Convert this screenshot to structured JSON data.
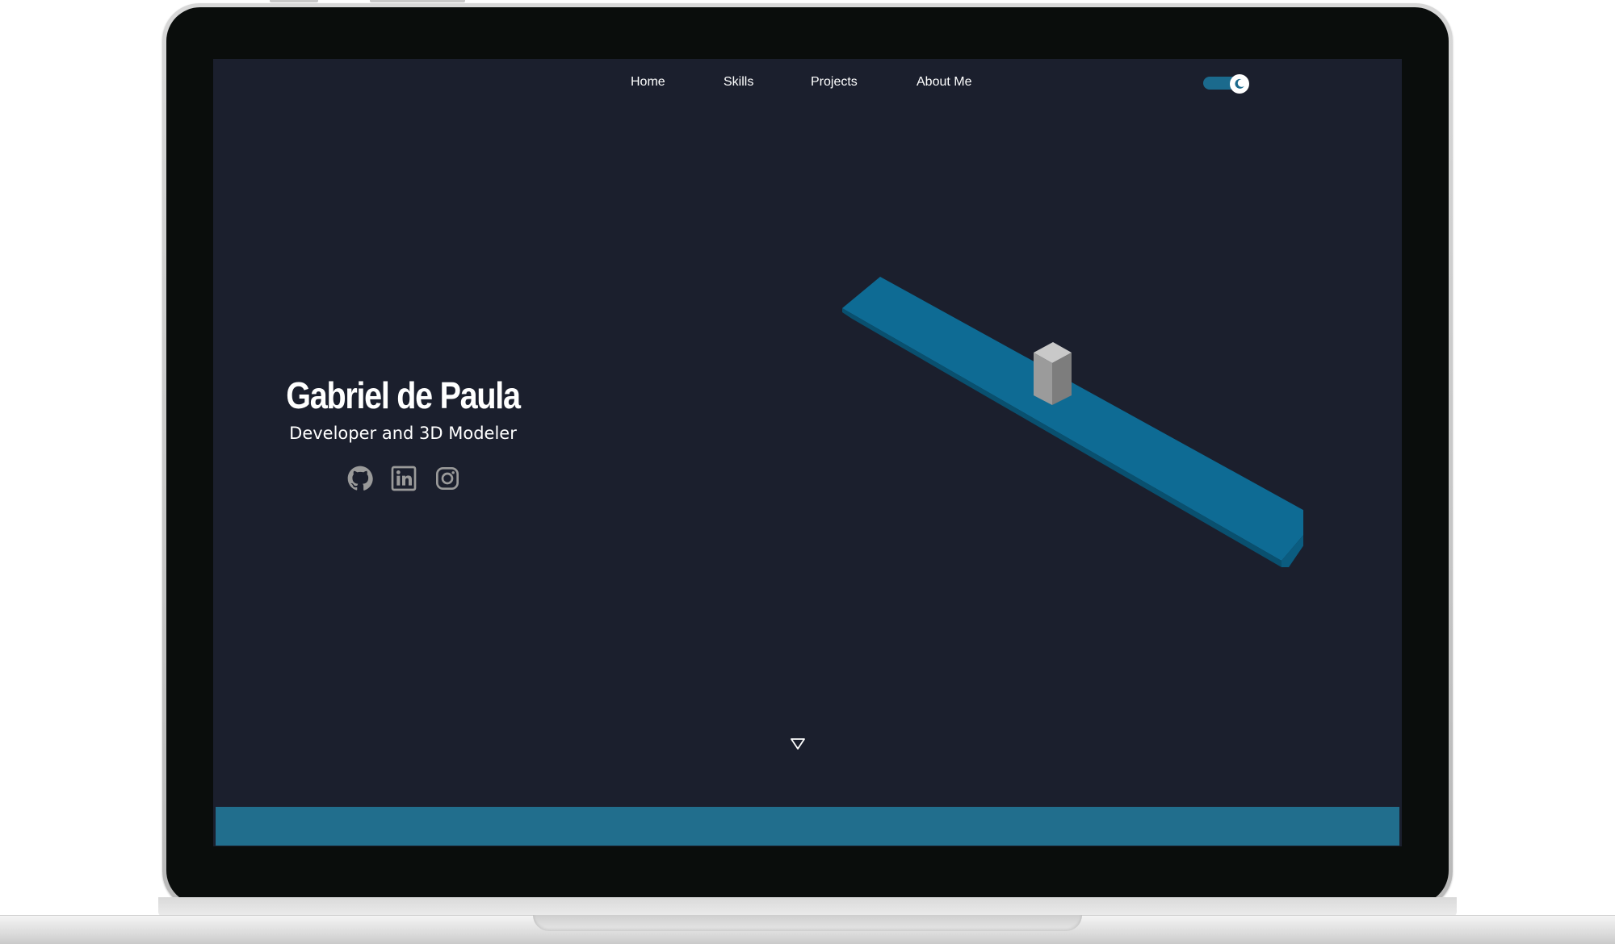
{
  "nav": {
    "items": [
      {
        "label": "Home"
      },
      {
        "label": "Skills"
      },
      {
        "label": "Projects"
      },
      {
        "label": "About Me"
      }
    ],
    "theme_toggle": {
      "state": "dark",
      "icon": "moon-icon"
    }
  },
  "hero": {
    "name": "Gabriel de Paula",
    "subtitle": "Developer and 3D Modeler",
    "socials": [
      {
        "icon": "github-icon"
      },
      {
        "icon": "linkedin-icon"
      },
      {
        "icon": "instagram-icon"
      }
    ]
  },
  "scroll_indicator": {
    "icon": "triangle-down-icon"
  },
  "colors": {
    "background": "#1b1f2d",
    "accent": "#216e8d",
    "platform_top": "#0e6b94",
    "platform_side": "#09506f",
    "text": "#ffffff",
    "icon": "#9a9a9a"
  }
}
